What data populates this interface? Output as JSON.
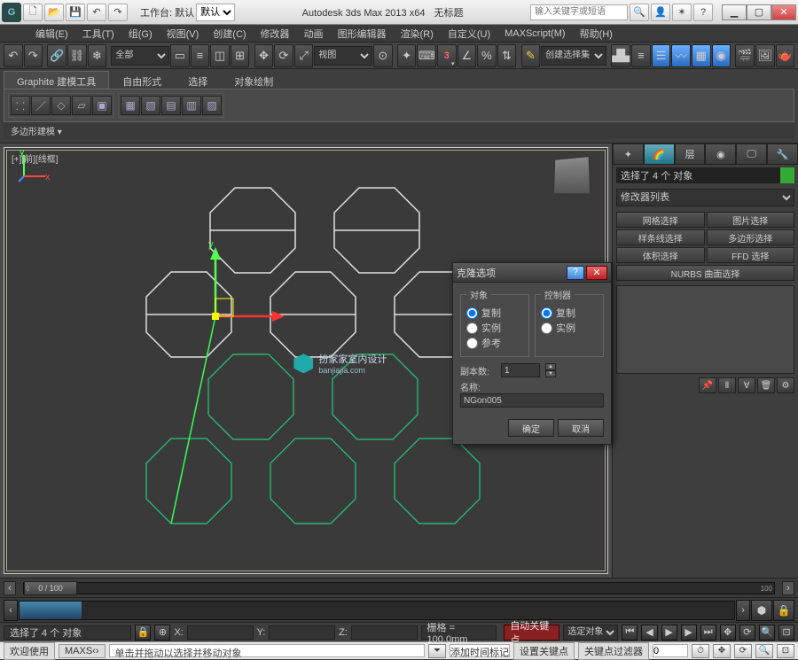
{
  "titlebar": {
    "workspace_label": "工作台: 默认",
    "workspace_options": [
      "默认"
    ],
    "app_title": "Autodesk 3ds Max 2013 x64",
    "doc_title": "无标题",
    "search_placeholder": "输入关键字或短语"
  },
  "menus": [
    "编辑(E)",
    "工具(T)",
    "组(G)",
    "视图(V)",
    "创建(C)",
    "修改器",
    "动画",
    "图形编辑器",
    "渲染(R)",
    "自定义(U)",
    "MAXScript(M)",
    "帮助(H)"
  ],
  "toolbar": {
    "selset_placeholder": "创建选择集"
  },
  "ribbon": {
    "tabs": [
      "Graphite 建模工具",
      "自由形式",
      "选择",
      "对象绘制"
    ],
    "active_tab": 0,
    "footer": "多边形建模 ▾"
  },
  "viewport": {
    "label": "[+][前][线框]",
    "watermark_line1": "扮家家室内设计",
    "watermark_line2": "banjiajia.com"
  },
  "cmd_panel": {
    "sel_status": "选择了 4 个 对象",
    "modlist_label": "修改器列表",
    "buttons": [
      "网格选择",
      "图片选择",
      "样条线选择",
      "多边形选择",
      "体积选择",
      "FFD 选择"
    ],
    "nurbs_btn": "NURBS 曲面选择"
  },
  "dialog": {
    "title": "克隆选项",
    "group_object": "对象",
    "group_ctrl": "控制器",
    "opt_copy": "复制",
    "opt_instance": "实例",
    "opt_reference": "参考",
    "copies_label": "副本数:",
    "copies_value": "1",
    "name_label": "名称:",
    "name_value": "NGon005",
    "ok": "确定",
    "cancel": "取消"
  },
  "timeline": {
    "slider_label": "0 / 100",
    "end": "100"
  },
  "status1": {
    "sel": "选择了 4 个 对象",
    "x": "X:",
    "y": "Y:",
    "z": "Z:",
    "grid_label": "栅格 = 100.0mm",
    "auto_key": "自动关键点",
    "sel_combo": "选定对象",
    "add_time_tag": "添加时间标记"
  },
  "status2": {
    "tab1": "欢迎使用",
    "tab2": "MAXS‹›",
    "prompt": "单击并拖动以选择并移动对象",
    "set_key": "设置关键点",
    "key_filter": "关键点过滤器"
  }
}
